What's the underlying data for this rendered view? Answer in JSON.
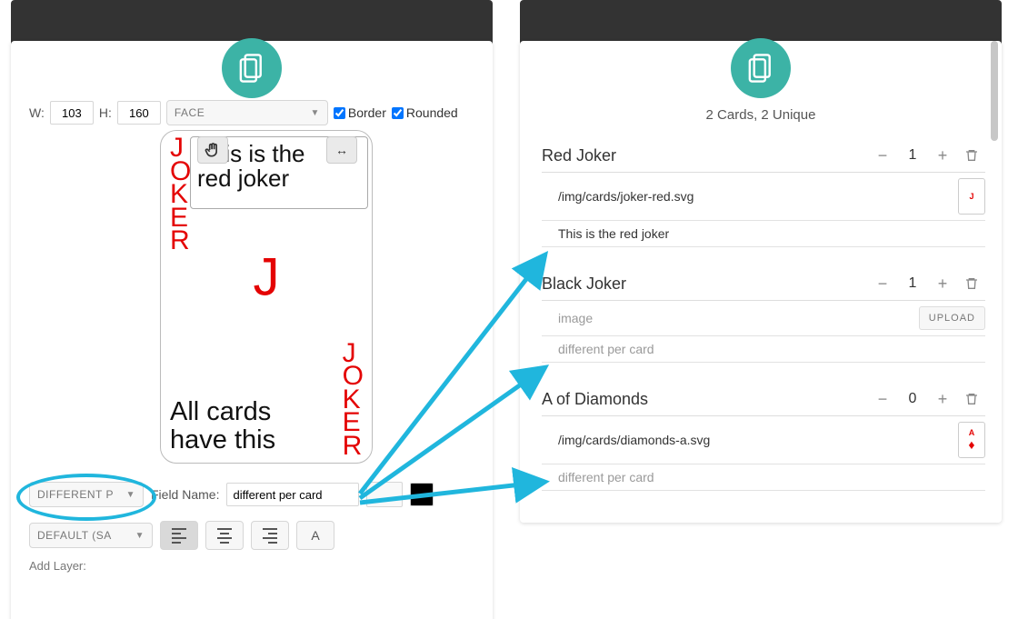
{
  "left": {
    "w_label": "W:",
    "h_label": "H:",
    "w": "103",
    "h": "160",
    "side_dd": "FACE",
    "border_label": "Border",
    "rounded_label": "Rounded",
    "card": {
      "joker_letters": [
        "J",
        "O",
        "K",
        "E",
        "R"
      ],
      "center": "J",
      "diff_text_l1": "This is the",
      "diff_text_l2": "red joker",
      "common_l1": "All cards",
      "common_l2": "have this"
    },
    "field_dd": "DIFFERENT P",
    "field_name_label": "Field Name:",
    "field_name_value": "different per card",
    "font_size": "",
    "font_dd": "DEFAULT (SA",
    "cap_a": "A",
    "add_layer_label": "Add Layer:"
  },
  "right": {
    "summary": "2 Cards, 2 Unique",
    "upload_label": "UPLOAD",
    "cards": [
      {
        "title": "Red Joker",
        "qty": "1",
        "fields": [
          {
            "text": "/img/cards/joker-red.svg",
            "ph": false,
            "thumb": "red-joker"
          },
          {
            "text": "This is the red joker",
            "ph": false
          }
        ]
      },
      {
        "title": "Black Joker",
        "qty": "1",
        "fields": [
          {
            "text": "image",
            "ph": true,
            "upload": true
          },
          {
            "text": "different per card",
            "ph": true
          }
        ]
      },
      {
        "title": "A of Diamonds",
        "qty": "0",
        "fields": [
          {
            "text": "/img/cards/diamonds-a.svg",
            "ph": false,
            "thumb": "diamond"
          },
          {
            "text": "different per card",
            "ph": true
          }
        ]
      }
    ]
  }
}
